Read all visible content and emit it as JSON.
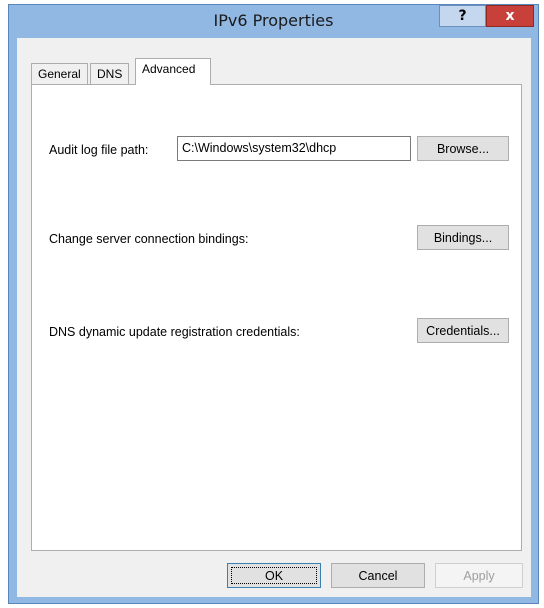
{
  "window": {
    "title": "IPv6 Properties",
    "help_label": "?",
    "close_label": "x"
  },
  "tabs": [
    {
      "label": "General",
      "active": false
    },
    {
      "label": "DNS",
      "active": false
    },
    {
      "label": "Advanced",
      "active": true
    }
  ],
  "advanced": {
    "audit_log_label": "Audit log file path:",
    "audit_log_value": "C:\\Windows\\system32\\dhcp",
    "browse_label": "Browse...",
    "bindings_text": "Change server connection bindings:",
    "bindings_label": "Bindings...",
    "credentials_text": "DNS dynamic update registration credentials:",
    "credentials_label": "Credentials..."
  },
  "footer": {
    "ok_label": "OK",
    "cancel_label": "Cancel",
    "apply_label": "Apply"
  },
  "colors": {
    "frame": "#91b7e3",
    "close_button": "#c7413a"
  }
}
